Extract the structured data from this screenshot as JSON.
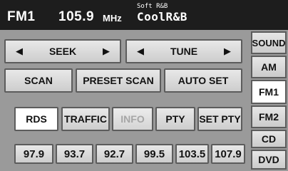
{
  "header": {
    "band": "FM1",
    "frequency": "105.9",
    "unit": "MHz",
    "pty_type": "Soft R&B",
    "station_name": "CoolR&B"
  },
  "controls": {
    "seek_label": "SEEK",
    "tune_label": "TUNE",
    "seek_left_icon": "◀",
    "seek_right_icon": "▶",
    "tune_left_icon": "◀",
    "tune_right_icon": "▶",
    "scan": "SCAN",
    "preset_scan": "PRESET SCAN",
    "auto_set": "AUTO SET",
    "rds": "RDS",
    "traffic": "TRAFFIC",
    "info": "INFO",
    "pty": "PTY",
    "set_pty": "SET PTY"
  },
  "presets": [
    "97.9",
    "93.7",
    "92.7",
    "99.5",
    "103.5",
    "107.9"
  ],
  "source_menu": {
    "sound": "SOUND",
    "am": "AM",
    "fm1": "FM1",
    "fm2": "FM2",
    "cd": "CD",
    "dvd": "DVD",
    "selected": "FM1"
  },
  "colors": {
    "header_bg": "#1d1d1d",
    "panel_bg": "#9a9a9a",
    "button_bg": "#d8d8d8",
    "button_active_bg": "#ffffff",
    "disabled_text": "#a6a6a6"
  }
}
